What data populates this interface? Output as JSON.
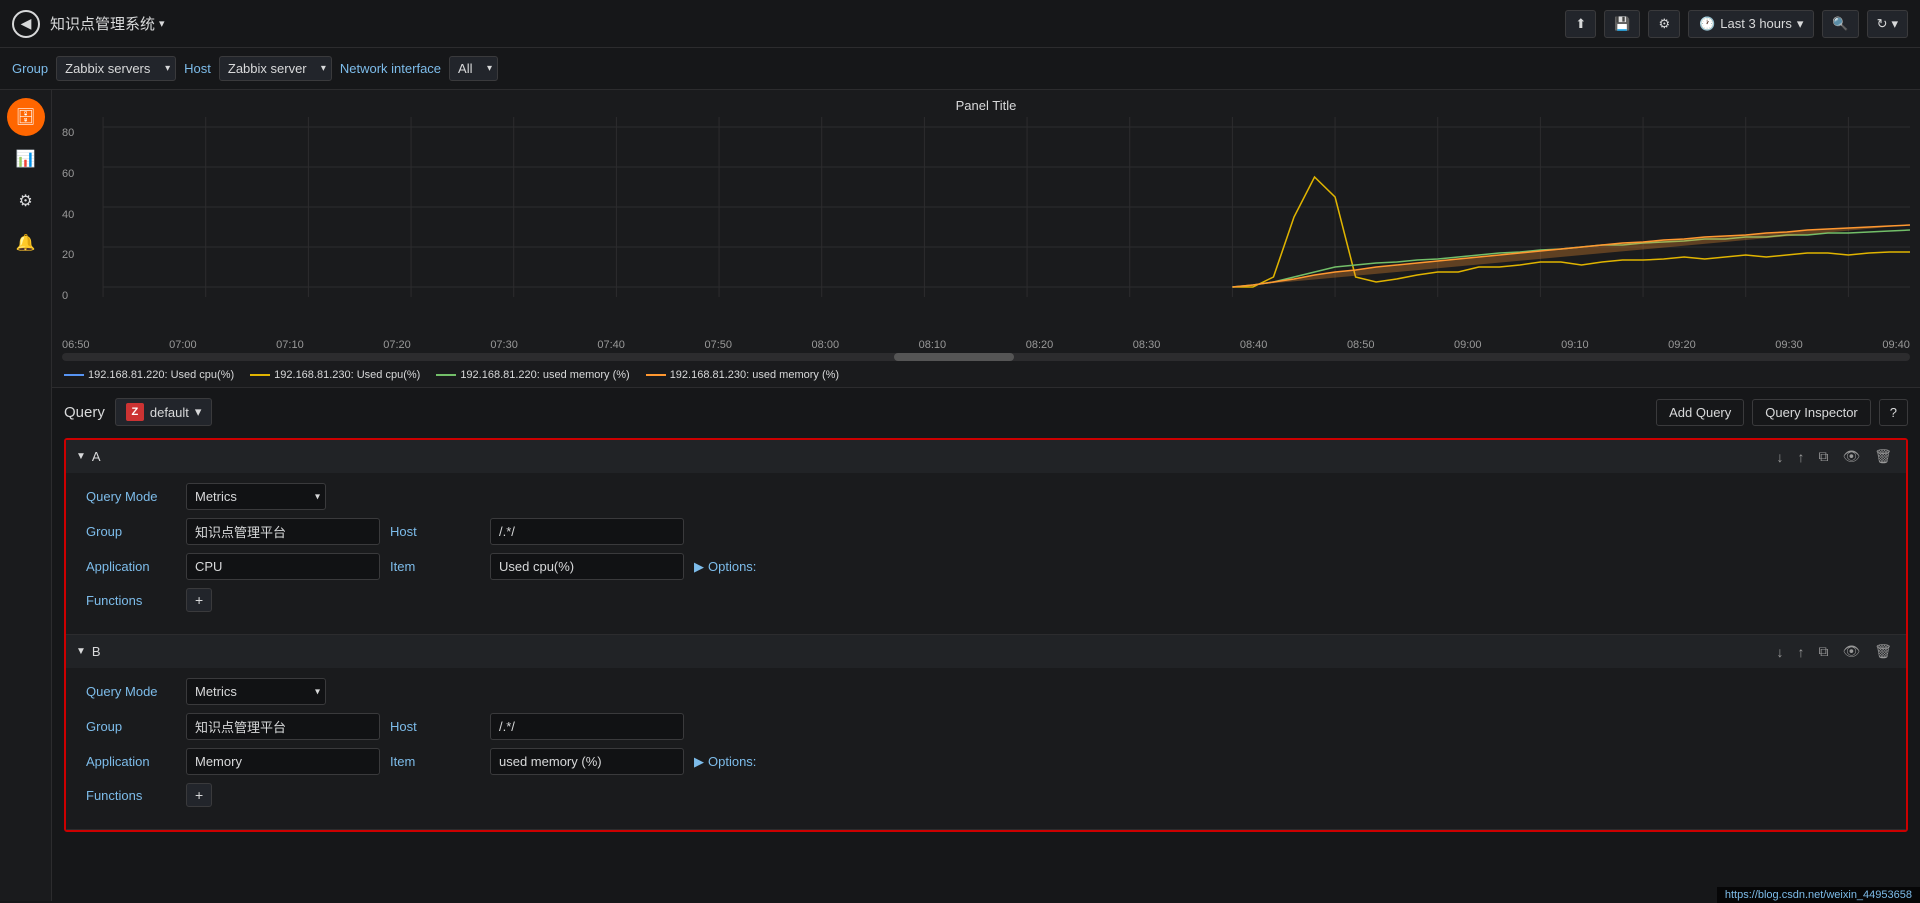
{
  "topbar": {
    "back_icon": "◀",
    "title": "知识点管理系统",
    "title_arrow": "▾",
    "icons": {
      "share": "⬆",
      "save": "💾",
      "settings": "⚙",
      "time_label": "Last 3 hours",
      "time_arrow": "▾",
      "search": "🔍",
      "refresh": "↻",
      "refresh_arrow": "▾"
    }
  },
  "filterbar": {
    "group_label": "Group",
    "group_value": "Zabbix servers",
    "host_label": "Host",
    "host_value": "Zabbix server",
    "network_label": "Network interface",
    "network_value": "All"
  },
  "chart": {
    "panel_title": "Panel Title",
    "y_labels": [
      "80",
      "60",
      "40",
      "20",
      "0"
    ],
    "x_labels": [
      "06:50",
      "07:00",
      "07:10",
      "07:20",
      "07:30",
      "07:40",
      "07:50",
      "08:00",
      "08:10",
      "08:20",
      "08:30",
      "08:40",
      "08:50",
      "09:00",
      "09:10",
      "09:20",
      "09:30",
      "09:40"
    ],
    "legend": [
      {
        "color": "#5794f2",
        "text": "192.168.81.220: Used cpu(%)"
      },
      {
        "color": "#e0b400",
        "text": "192.168.81.230: Used cpu(%)"
      },
      {
        "color": "#73bf69",
        "text": "192.168.81.220: used memory (%)"
      },
      {
        "color": "#ff9830",
        "text": "192.168.81.230: used memory (%)"
      }
    ]
  },
  "query_section": {
    "query_label": "Query",
    "datasource_logo": "Z",
    "datasource_name": "default",
    "datasource_arrow": "▾",
    "add_query_btn": "Add Query",
    "inspector_btn": "Query Inspector",
    "help_btn": "?",
    "blocks": [
      {
        "id": "A",
        "arrow": "▼",
        "query_mode_label": "Query Mode",
        "query_mode_value": "Metrics",
        "group_label": "Group",
        "group_value": "知识点管理平台",
        "host_label": "Host",
        "host_value": "/.*/ ",
        "application_label": "Application",
        "application_value": "CPU",
        "item_label": "Item",
        "item_value": "Used cpu(%)",
        "options_label": "▶ Options:",
        "functions_label": "Functions",
        "add_func": "+"
      },
      {
        "id": "B",
        "arrow": "▼",
        "query_mode_label": "Query Mode",
        "query_mode_value": "Metrics",
        "group_label": "Group",
        "group_value": "知识点管理平台",
        "host_label": "Host",
        "host_value": "/.*/ ",
        "application_label": "Application",
        "application_value": "Memory",
        "item_label": "Item",
        "item_value": "used memory (%)",
        "options_label": "▶ Options:",
        "functions_label": "Functions",
        "add_func": "+"
      }
    ]
  },
  "sidebar": {
    "icons": [
      {
        "name": "database-icon",
        "glyph": "🗄",
        "active": true
      },
      {
        "name": "chart-icon",
        "glyph": "📊",
        "active": false
      },
      {
        "name": "settings-icon",
        "glyph": "⚙",
        "active": false
      },
      {
        "name": "bell-icon",
        "glyph": "🔔",
        "active": false
      }
    ]
  },
  "footer": {
    "url": "https://blog.csdn.net/weixin_44953658"
  }
}
